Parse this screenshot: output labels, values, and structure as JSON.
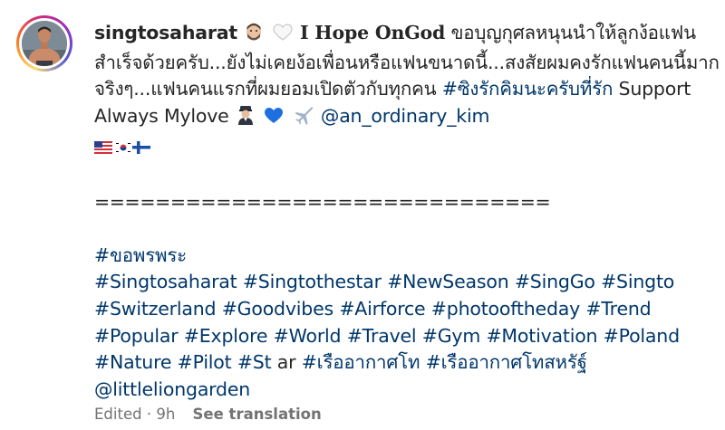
{
  "post": {
    "username": "singtosaharat",
    "headline": "I Hope OnGod",
    "caption_part1": " ขอบุญกุศลหนุนนำให้ลูกง้อแฟนสำเร็จด้วยครับ...ยังไม่เคยง้อเพื่อนหรือแฟนขนาดนี้...สงสัยผมคงรักแฟนคนนี้มากจริงๆ...แฟนคนแรกที่ผมยอมเปิดตัวกับทุกคน ",
    "hashtag_thai_love": "#ซิงรักคิมนะครับที่รัก",
    "caption_part2": " Support Always Mylove ",
    "mention_partner": "@an_ordinary_kim",
    "divider": "==============================",
    "hashtag_blessing": "#ขอพรพระ",
    "hashtags_line1": [
      {
        "text": "#Singtosaharat"
      },
      {
        "text": "#Singtothestar"
      },
      {
        "text": "#NewSeason"
      },
      {
        "text": "#SingGo"
      },
      {
        "text": "#Singto"
      }
    ],
    "hashtags_line2": [
      {
        "text": "#Switzerland"
      },
      {
        "text": "#Goodvibes"
      },
      {
        "text": "#Airforce"
      },
      {
        "text": "#photooftheday"
      },
      {
        "text": "#Trend"
      }
    ],
    "hashtags_line3": [
      {
        "text": "#Popular"
      },
      {
        "text": "#Explore"
      },
      {
        "text": "#World"
      },
      {
        "text": "#Travel"
      },
      {
        "text": "#Gym"
      },
      {
        "text": "#Motivation"
      },
      {
        "text": "#Poland"
      }
    ],
    "hashtags_line4_a": [
      {
        "text": "#Nature"
      },
      {
        "text": "#Pilot"
      },
      {
        "text": "#St"
      }
    ],
    "plain_ar": " ar ",
    "hashtags_line4_b": [
      {
        "text": "#เรืออากาศโท"
      },
      {
        "text": "#เรืออากาศโทสหรัฐ์"
      }
    ],
    "mention_garden": "@littleliongarden",
    "edited_label": "Edited",
    "time_ago": "9h",
    "see_translation": "See translation"
  },
  "colors": {
    "text": "#262626",
    "link": "#00376b",
    "meta": "#737373"
  },
  "icons": [
    "avatar",
    "face-emoji-icon",
    "white-heart-icon",
    "pilot-emoji-icon",
    "blue-heart-icon",
    "airplane-icon",
    "us-flag-icon",
    "korea-flag-icon",
    "finland-flag-icon"
  ]
}
